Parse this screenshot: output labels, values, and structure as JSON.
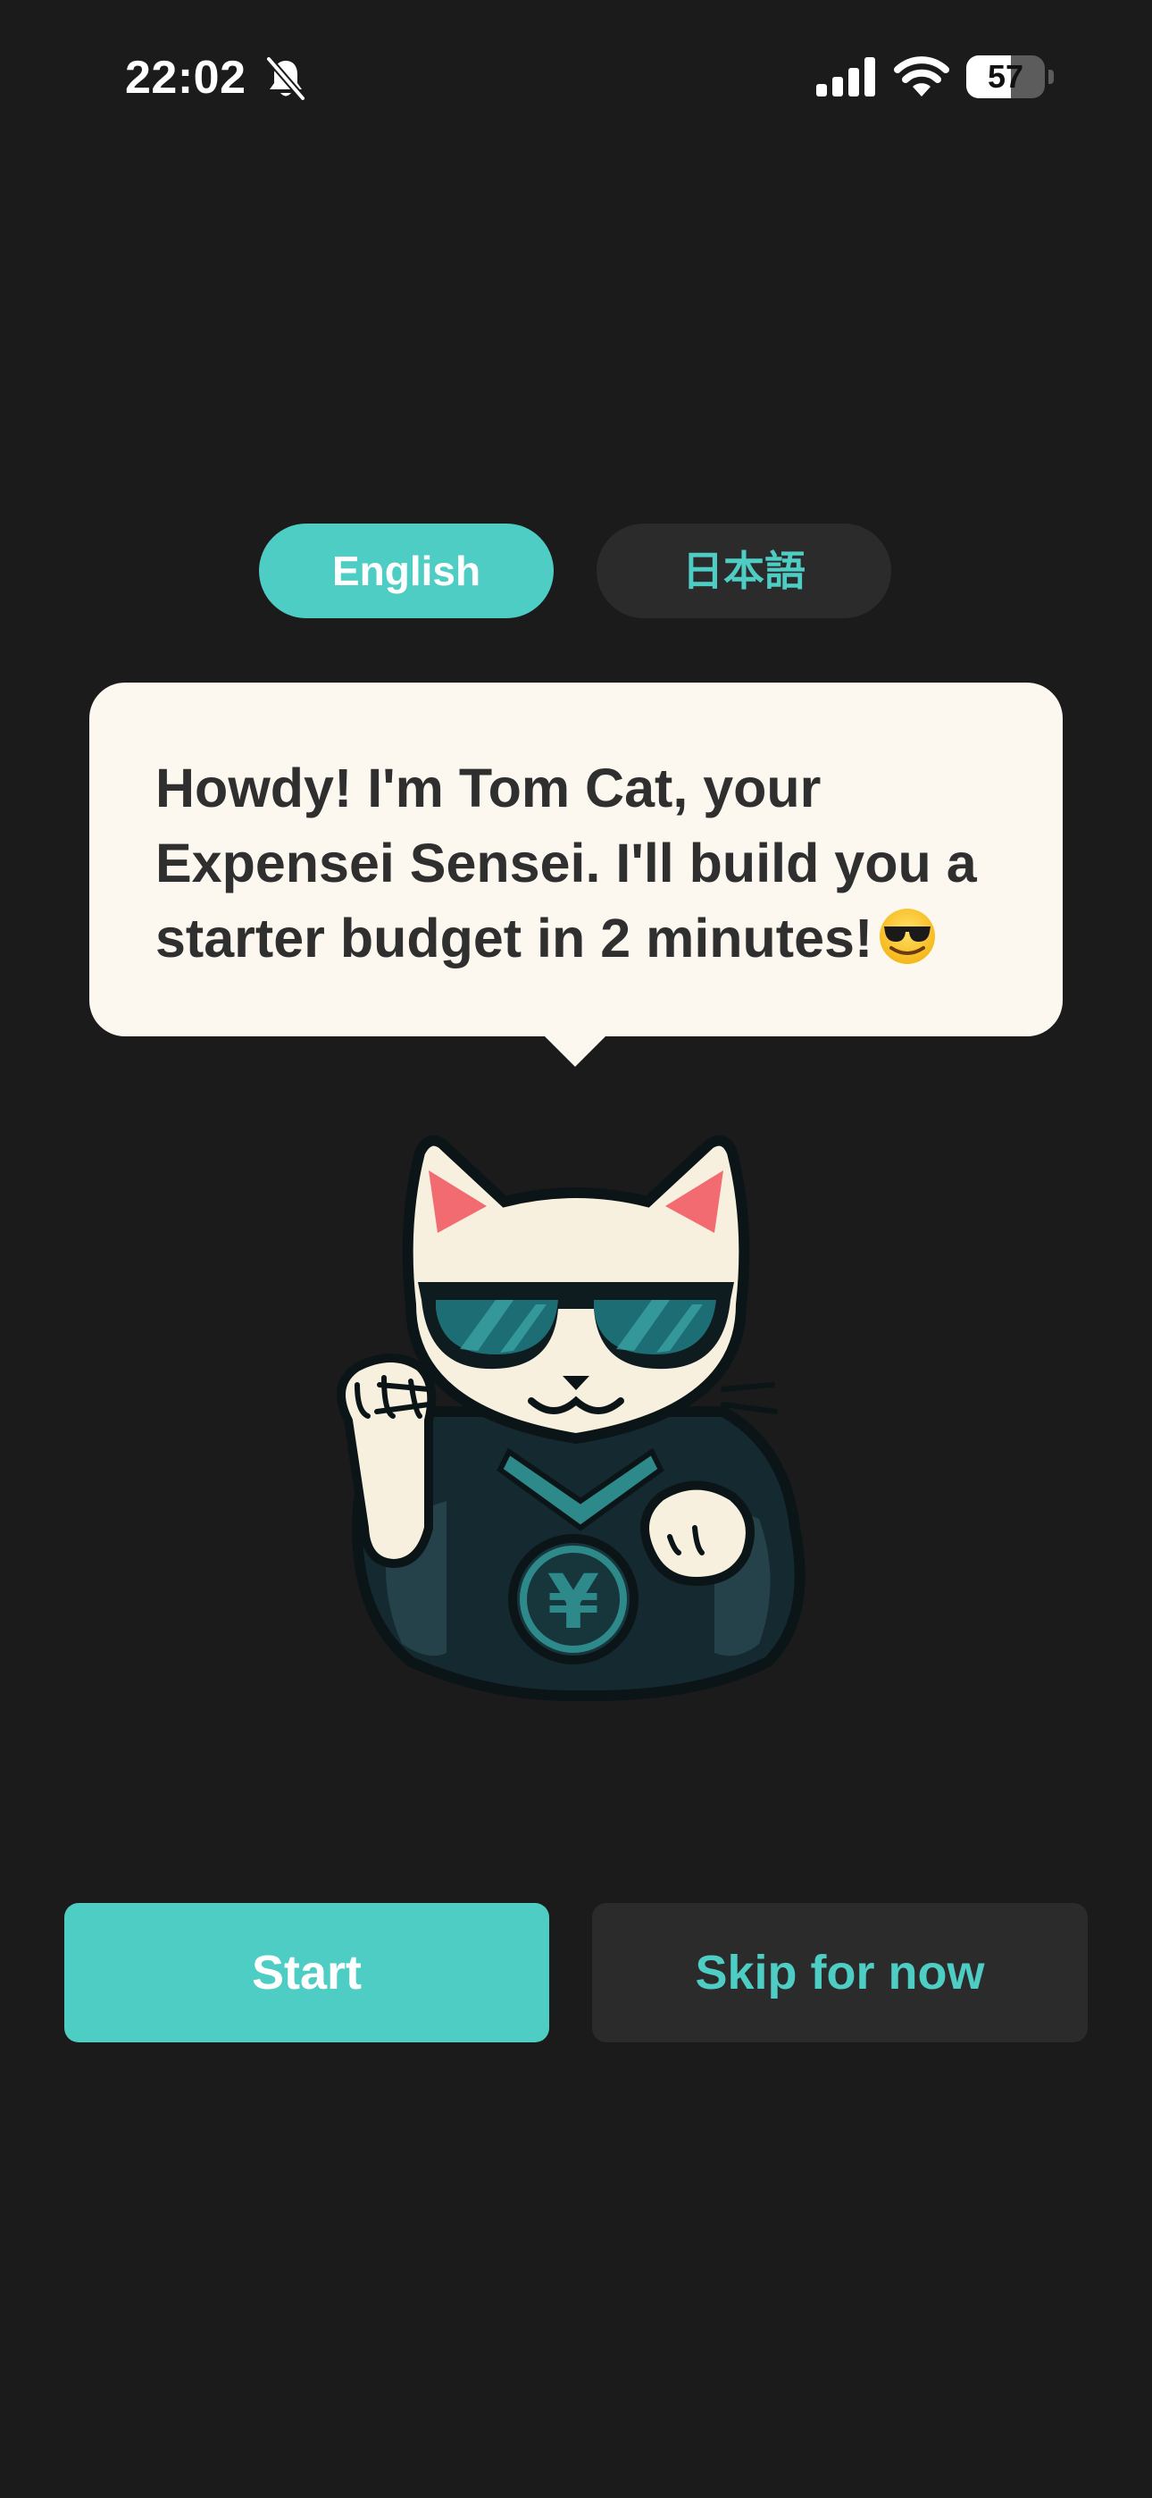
{
  "status_bar": {
    "time": "22:02",
    "battery_percent": "57",
    "battery_level": 0.57,
    "icons": [
      "bell-slash-icon",
      "cellular-signal-icon",
      "wifi-icon",
      "battery-icon"
    ]
  },
  "language_toggle": {
    "selected": "English",
    "options": [
      "English",
      "日本語"
    ]
  },
  "speech_bubble": {
    "message": "Howdy! I'm Tom Cat, your Expensei Sensei. I'll build you a starter budget in 2 minutes!",
    "emoji": "smiling-face-with-sunglasses-icon"
  },
  "mascot": {
    "icon": "maneki-neko-cat-sunglasses-yen-icon",
    "medallion_symbol": "¥"
  },
  "actions": {
    "start_label": "Start",
    "skip_label": "Skip for now"
  },
  "colors": {
    "background": "#1b1b1b",
    "accent": "#4ecdc4",
    "secondary_button": "#2b2b2b",
    "bubble": "#fdf8ef",
    "bubble_text": "#2f2f2f"
  }
}
